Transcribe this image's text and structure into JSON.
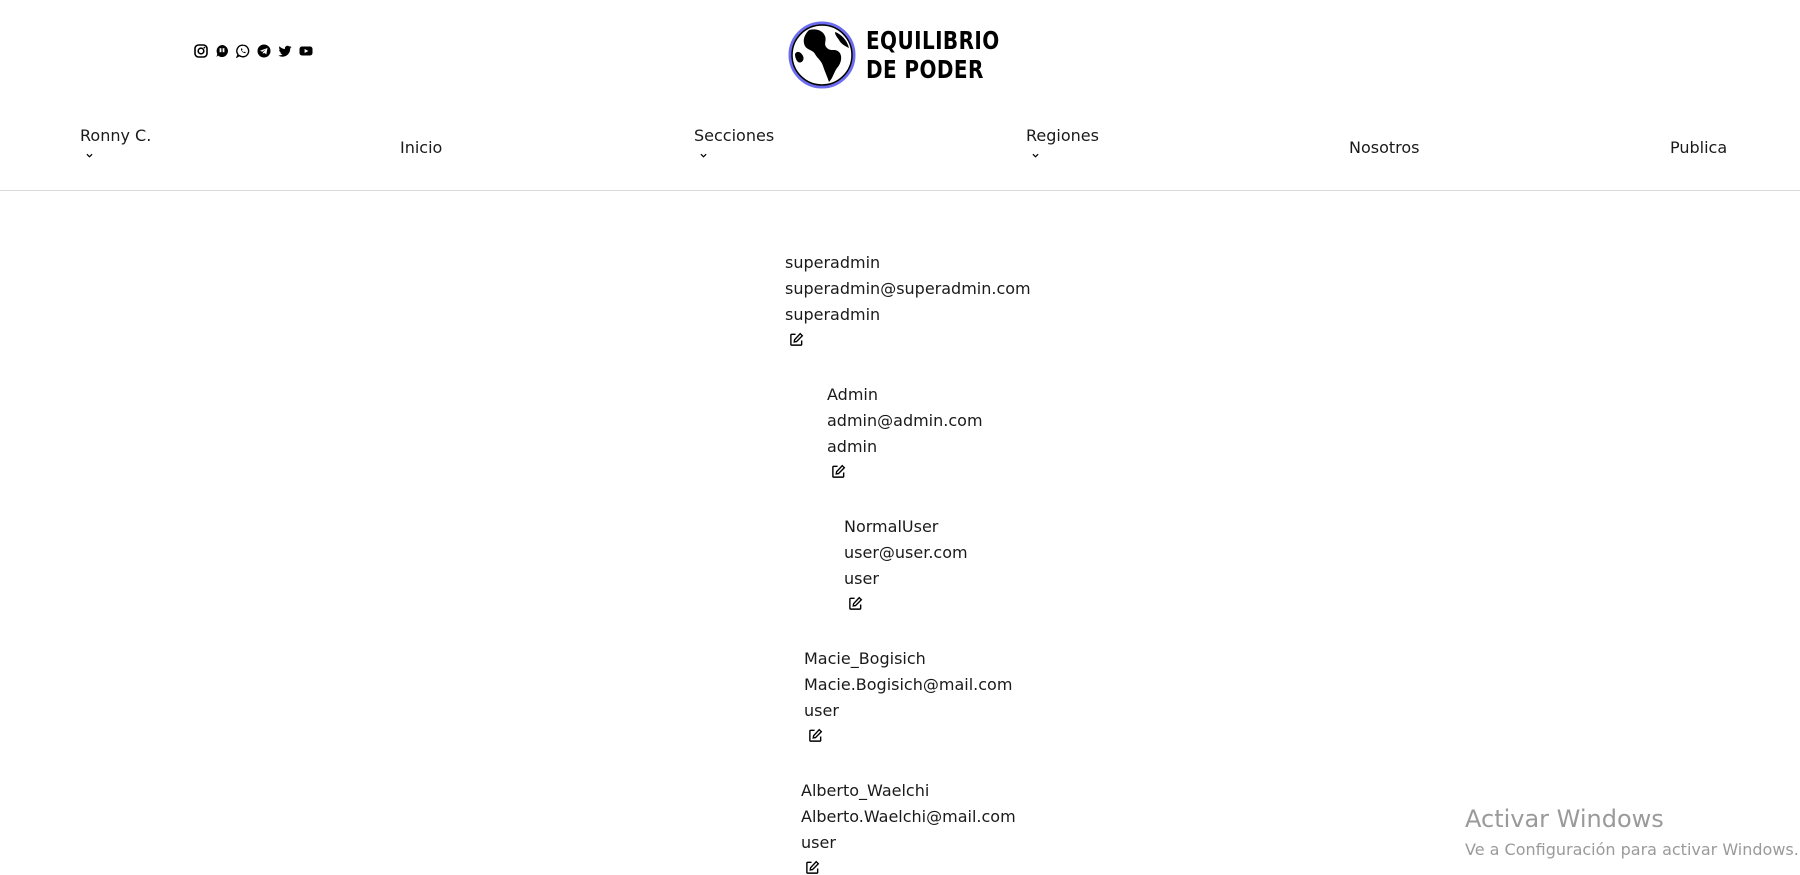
{
  "social": [
    "instagram-icon",
    "ivoox-icon",
    "whatsapp-icon",
    "telegram-icon",
    "twitter-icon",
    "youtube-icon"
  ],
  "logo": {
    "line1": "EQUILIBRIO",
    "line2": "DE PODER"
  },
  "nav": {
    "user": "Ronny C.",
    "inicio": "Inicio",
    "secciones": "Secciones",
    "regiones": "Regiones",
    "nosotros": "Nosotros",
    "publica": "Publica"
  },
  "users": [
    {
      "name": "superadmin",
      "email": "superadmin@superadmin.com",
      "role": "superadmin"
    },
    {
      "name": "Admin",
      "email": "admin@admin.com",
      "role": "admin"
    },
    {
      "name": "NormalUser",
      "email": "user@user.com",
      "role": "user"
    },
    {
      "name": "Macie_Bogisich",
      "email": "Macie.Bogisich@mail.com",
      "role": "user"
    },
    {
      "name": "Alberto_Waelchi",
      "email": "Alberto.Waelchi@mail.com",
      "role": "user"
    }
  ],
  "watermark": {
    "title": "Activar Windows",
    "subtitle": "Ve a Configuración para activar Windows."
  }
}
